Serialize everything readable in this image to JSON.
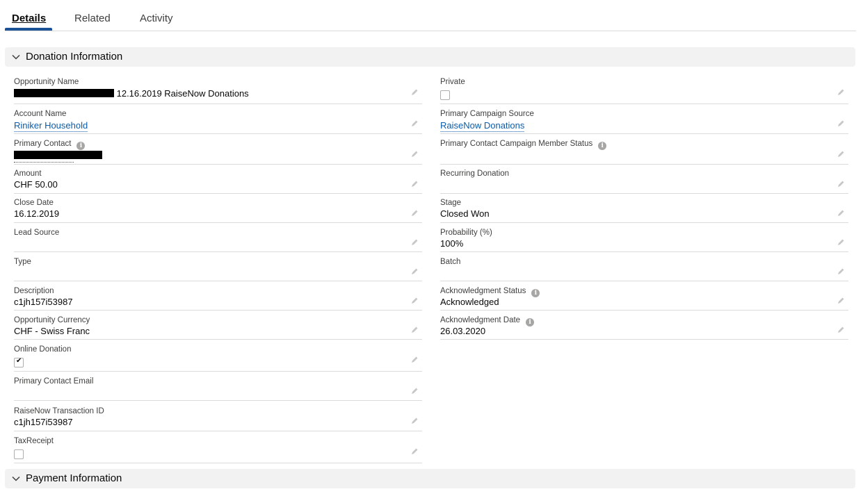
{
  "tabs": [
    {
      "label": "Details",
      "active": true
    },
    {
      "label": "Related",
      "active": false
    },
    {
      "label": "Activity",
      "active": false
    }
  ],
  "sections": {
    "donation": {
      "title": "Donation Information"
    },
    "payment": {
      "title": "Payment Information"
    }
  },
  "left_fields": {
    "opportunity_name": {
      "label": "Opportunity Name",
      "value": " 12.16.2019 RaiseNow Donations"
    },
    "account_name": {
      "label": "Account Name",
      "value": "Riniker Household"
    },
    "primary_contact": {
      "label": "Primary Contact"
    },
    "amount": {
      "label": "Amount",
      "value": "CHF 50.00"
    },
    "close_date": {
      "label": "Close Date",
      "value": "16.12.2019"
    },
    "lead_source": {
      "label": "Lead Source",
      "value": ""
    },
    "type": {
      "label": "Type",
      "value": ""
    },
    "description": {
      "label": "Description",
      "value": "c1jh157i53987"
    },
    "opportunity_currency": {
      "label": "Opportunity Currency",
      "value": "CHF - Swiss Franc"
    },
    "online_donation": {
      "label": "Online Donation",
      "checked": true
    },
    "primary_contact_email": {
      "label": "Primary Contact Email",
      "value": ""
    },
    "raisenow_transaction_id": {
      "label": "RaiseNow Transaction ID",
      "value": "c1jh157i53987"
    },
    "tax_receipt": {
      "label": "TaxReceipt",
      "checked": false
    }
  },
  "right_fields": {
    "private": {
      "label": "Private",
      "checked": false
    },
    "primary_campaign_source": {
      "label": "Primary Campaign Source",
      "value": "RaiseNow Donations"
    },
    "primary_contact_campaign_member_status": {
      "label": "Primary Contact Campaign Member Status",
      "value": ""
    },
    "recurring_donation": {
      "label": "Recurring Donation",
      "value": ""
    },
    "stage": {
      "label": "Stage",
      "value": "Closed Won"
    },
    "probability": {
      "label": "Probability (%)",
      "value": "100%"
    },
    "batch": {
      "label": "Batch",
      "value": ""
    },
    "acknowledgment_status": {
      "label": "Acknowledgment Status",
      "value": "Acknowledged"
    },
    "acknowledgment_date": {
      "label": "Acknowledgment Date",
      "value": "26.03.2020"
    }
  },
  "icons": {
    "info": "info-icon",
    "edit": "pencil-icon",
    "chevron": "chevron-down-icon"
  },
  "colors": {
    "link": "#0b5cab",
    "active_tab": "#1b5297",
    "section_bg": "#f3f2f2",
    "divider": "#dddbda"
  }
}
